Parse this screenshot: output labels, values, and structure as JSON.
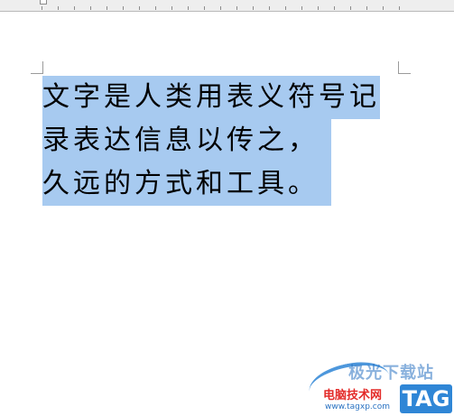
{
  "document": {
    "columns": [
      "文字是人类用表义符号记",
      "录表达信息以传之，",
      "久远的方式和工具。"
    ],
    "selection_color": "#a7caf0"
  },
  "watermark": {
    "top_text": "极光下载站",
    "main_text": "电脑技术网",
    "url": "www.tagxp.com",
    "badge": "TAG"
  }
}
